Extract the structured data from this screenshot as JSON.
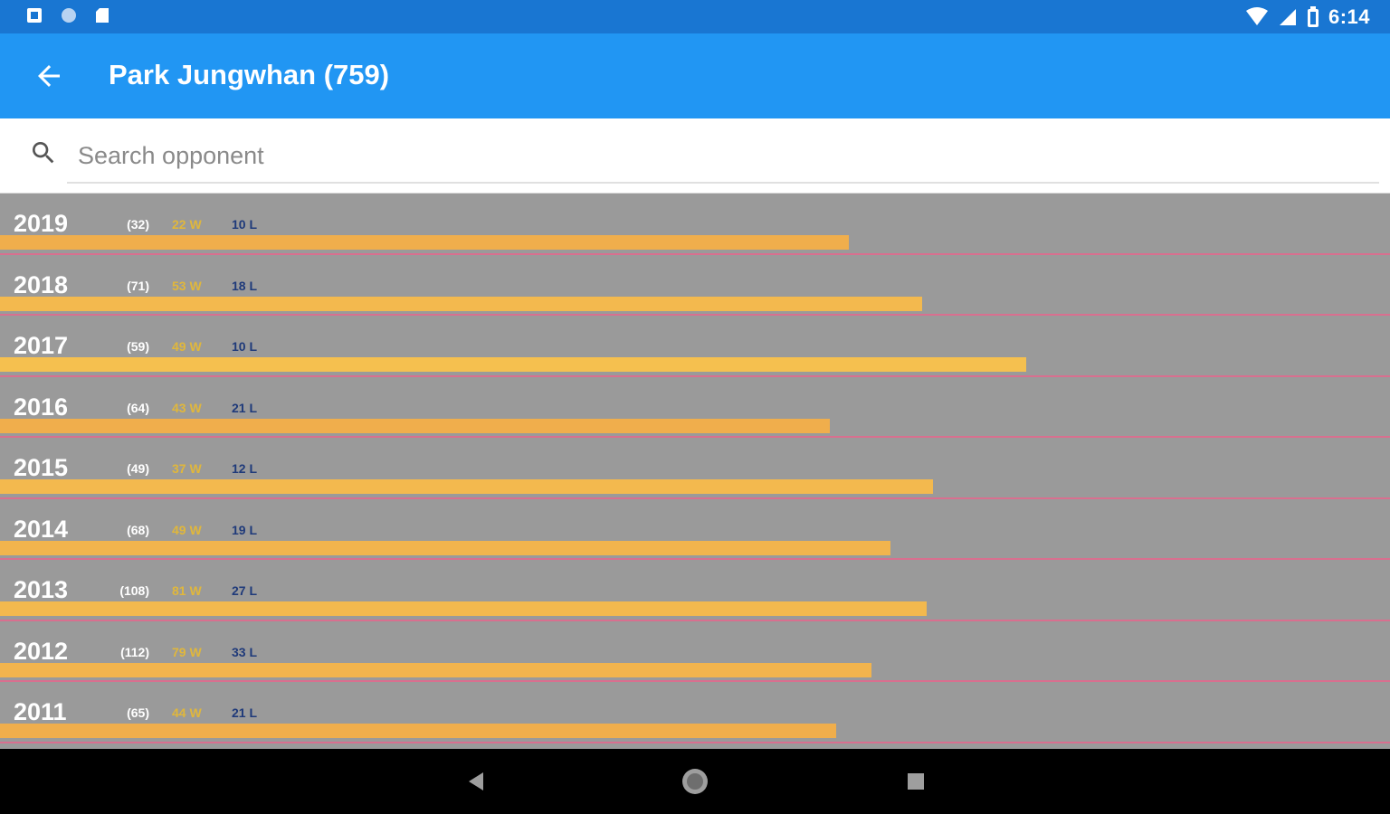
{
  "status_bar": {
    "time": "6:14",
    "icons": [
      "screenshot-icon",
      "circle-icon",
      "sd-card-icon",
      "wifi-icon",
      "signal-icon",
      "battery-icon"
    ]
  },
  "app_bar": {
    "title": "Park Jungwhan (759)",
    "back_icon": "arrow-back-icon"
  },
  "search": {
    "placeholder": "Search opponent",
    "value": ""
  },
  "years": [
    {
      "year": "2019",
      "games": "(32)",
      "wins": "22 W",
      "losses": "10 L",
      "win_rate": 0.6875,
      "color": "#f0ae4c"
    },
    {
      "year": "2018",
      "games": "(71)",
      "wins": "53 W",
      "losses": "18 L",
      "win_rate": 0.7465,
      "color": "#f3b94e"
    },
    {
      "year": "2017",
      "games": "(59)",
      "wins": "49 W",
      "losses": "10 L",
      "win_rate": 0.8305,
      "color": "#f5c04f"
    },
    {
      "year": "2016",
      "games": "(64)",
      "wins": "43 W",
      "losses": "21 L",
      "win_rate": 0.6719,
      "color": "#f0ae4c"
    },
    {
      "year": "2015",
      "games": "(49)",
      "wins": "37 W",
      "losses": "12 L",
      "win_rate": 0.7551,
      "color": "#f3b94e"
    },
    {
      "year": "2014",
      "games": "(68)",
      "wins": "49 W",
      "losses": "19 L",
      "win_rate": 0.7206,
      "color": "#f2b44d"
    },
    {
      "year": "2013",
      "games": "(108)",
      "wins": "81 W",
      "losses": "27 L",
      "win_rate": 0.75,
      "color": "#f3b94e"
    },
    {
      "year": "2012",
      "games": "(112)",
      "wins": "79 W",
      "losses": "33 L",
      "win_rate": 0.7054,
      "color": "#f2b44d"
    },
    {
      "year": "2011",
      "games": "(65)",
      "wins": "44 W",
      "losses": "21 L",
      "win_rate": 0.6769,
      "color": "#f0ae4c"
    }
  ],
  "nav_bar": {
    "buttons": [
      "back-triangle-icon",
      "home-circle-icon",
      "recents-square-icon"
    ]
  }
}
